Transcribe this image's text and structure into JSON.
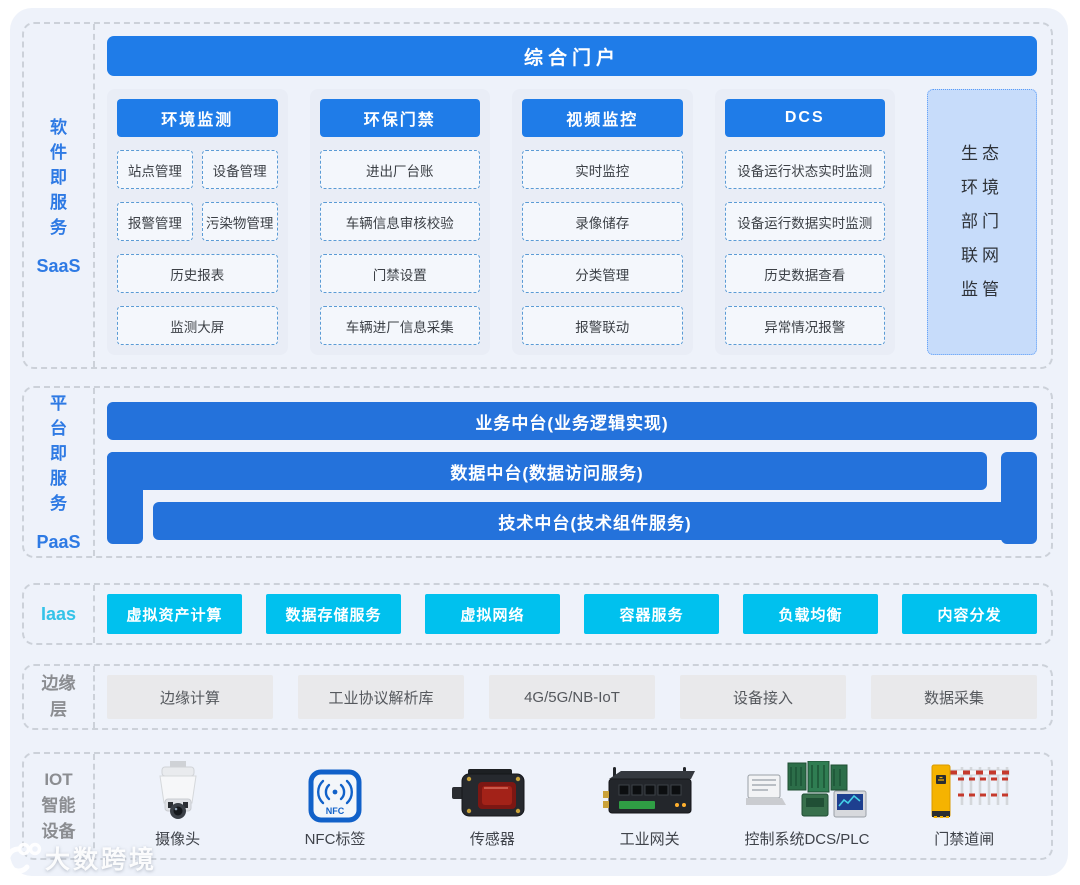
{
  "colors": {
    "panel-bg": "#eef2fa",
    "section-border": "#ccd1d9",
    "blue": "#1f7ce8",
    "paas-blue": "#2472db",
    "cyan": "#00c1ee",
    "cyan-label": "#35c3e8",
    "label-blue": "#2e7ae4",
    "col-bg": "#e9edf6",
    "item-border": "#5b9bd5",
    "item-bg": "#f4f7fc",
    "side-box-bg": "#c7dcfa",
    "side-box-border": "#5a9cf8",
    "gray-box-bg": "#e9e9eb",
    "gray-label": "#8b8d91",
    "text-dark": "#3c4046"
  },
  "saas": {
    "label_cn": "软\n件\n即\n服\n务",
    "label_en": "SaaS",
    "portal": "综合门户",
    "columns": [
      {
        "header": "环境监测",
        "rows": [
          [
            "站点管理",
            "设备管理"
          ],
          [
            "报警管理",
            "污染物管理"
          ],
          [
            "历史报表"
          ],
          [
            "监测大屏"
          ]
        ]
      },
      {
        "header": "环保门禁",
        "rows": [
          [
            "进出厂台账"
          ],
          [
            "车辆信息审核校验"
          ],
          [
            "门禁设置"
          ],
          [
            "车辆进厂信息采集"
          ]
        ]
      },
      {
        "header": "视频监控",
        "rows": [
          [
            "实时监控"
          ],
          [
            "录像储存"
          ],
          [
            "分类管理"
          ],
          [
            "报警联动"
          ]
        ]
      },
      {
        "header": "DCS",
        "rows": [
          [
            "设备运行状态实时监测"
          ],
          [
            "设备运行数据实时监测"
          ],
          [
            "历史数据查看"
          ],
          [
            "异常情况报警"
          ]
        ]
      }
    ],
    "side_box": "生态\n环境\n部门\n联网\n监管"
  },
  "paas": {
    "label_cn": "平\n台\n即\n服\n务",
    "label_en": "PaaS",
    "bars": [
      "业务中台(业务逻辑实现)",
      "数据中台(数据访问服务)",
      "技术中台(技术组件服务)"
    ]
  },
  "iaas": {
    "label": "Iaas",
    "items": [
      "虚拟资产计算",
      "数据存储服务",
      "虚拟网络",
      "容器服务",
      "负载均衡",
      "内容分发"
    ]
  },
  "edge": {
    "label": "边缘\n层",
    "items": [
      "边缘计算",
      "工业协议解析库",
      "4G/5G/NB-IoT",
      "设备接入",
      "数据采集"
    ]
  },
  "iot": {
    "label": "IOT\n智能\n设备",
    "nfc_label": "NFC",
    "devices": [
      {
        "name": "摄像头"
      },
      {
        "name": "NFC标签"
      },
      {
        "name": "传感器"
      },
      {
        "name": "工业网关"
      },
      {
        "name": "控制系统DCS/PLC"
      },
      {
        "name": "门禁道闸"
      }
    ]
  },
  "watermark": "大数跨境"
}
